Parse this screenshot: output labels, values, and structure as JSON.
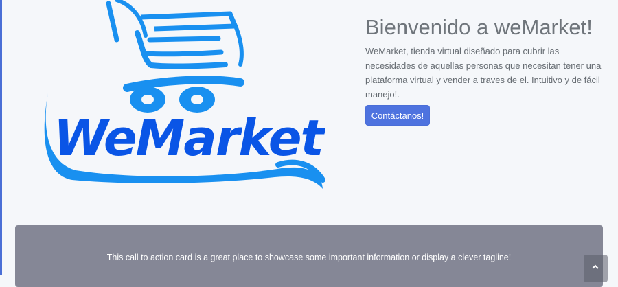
{
  "logo": {
    "text": "WeMarket",
    "primary_color": "#1990f0",
    "text_color": "#0a55e6"
  },
  "hero": {
    "title": "Bienvenido a weMarket!",
    "description": "WeMarket, tienda virtual diseñado para cubrir las necesidades de aquellas personas que necesitan tener una plataforma virtual y vender a traves de el. Intuitivo y de fácil manejo!.",
    "button_label": "Contáctanos!"
  },
  "cta": {
    "text": "This call to action card is a great place to showcase some important information or display a clever tagline!"
  },
  "scroll_top": {
    "icon": "chevron-up-icon"
  },
  "colors": {
    "accent": "#4e73df",
    "card": "#858796",
    "background": "#f5f7fa"
  }
}
